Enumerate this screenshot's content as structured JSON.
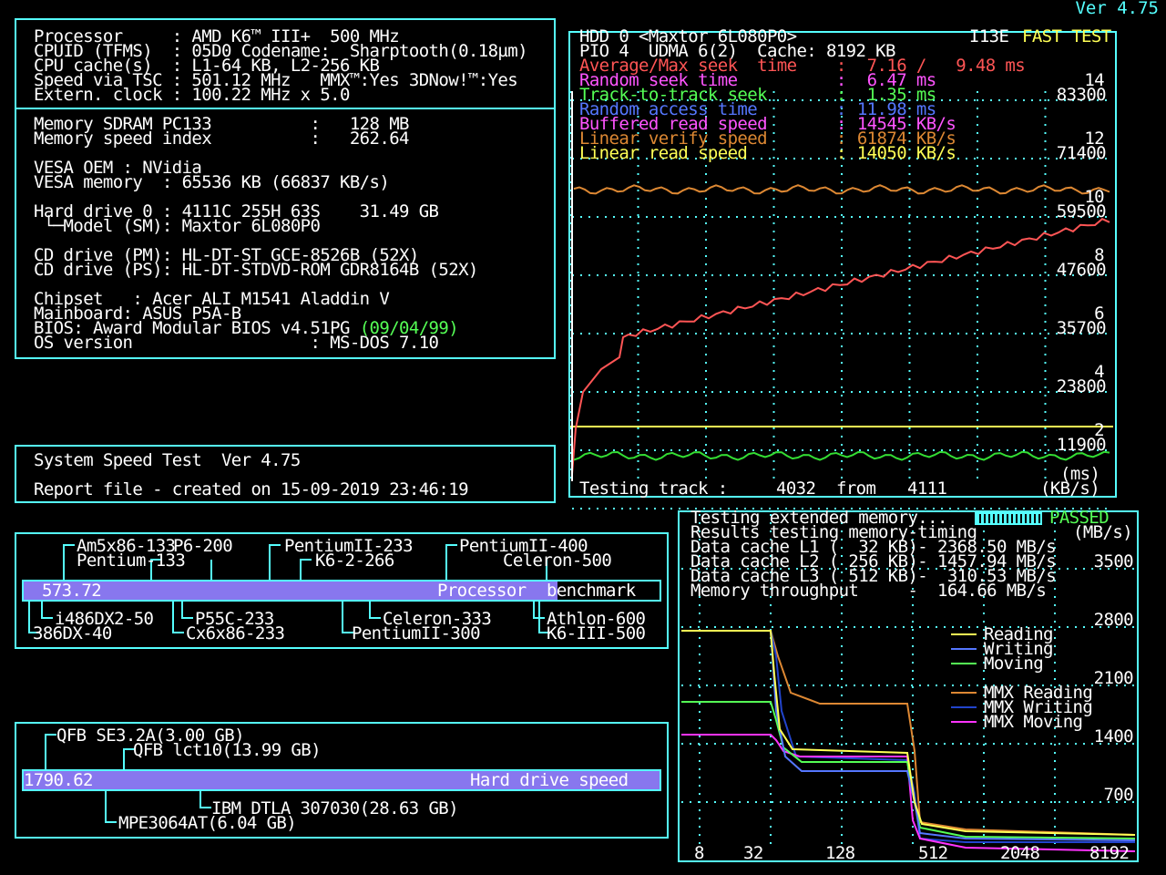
{
  "version_label": "Ver 4.75",
  "sysinfo": {
    "lines": [
      "Processor     : AMD K6™ III+  500 MHz",
      "CPUID (TFMS)  : 05D0 Codename:  Sharptooth(0.18µm)",
      "CPU cache(s)  : L1-64 KB, L2-256 KB",
      "Speed via TSC : 501.12 MHz   MMX™:Yes 3DNow!™:Yes",
      "Extern. clock : 100.22 MHz x 5.0"
    ],
    "memory_lines": [
      "Memory SDRAM PC133          :   128 MB",
      "Memory speed index          :   262.64"
    ],
    "vesa_lines": [
      "VESA OEM : NVidia",
      "VESA memory  : 65536 KB (66837 KB/s)"
    ],
    "hdd_lines": [
      "Hard drive 0 : 4111C 255H 63S    31.49 GB",
      " └─Model (SM): Maxtor 6L080P0"
    ],
    "cd_lines": [
      "CD drive (PM): HL-DT-ST GCE-8526B (52X)",
      "CD drive (PS): HL-DT-STDVD-ROM GDR8164B (52X)"
    ],
    "chip_lines": [
      "Chipset   : Acer ALI M1541 Aladdin V",
      "Mainboard: ASUS P5A-B"
    ],
    "bios_prefix": "BIOS: Award Modular BIOS v4.51PG ",
    "bios_date": "(09/04/99)",
    "os_line": "OS version                  : MS-DOS 7.10"
  },
  "report": {
    "line1": "System Speed Test  Ver 4.75",
    "line2": "Report file - created on 15-09-2019 23:46:19"
  },
  "hdd_test": {
    "header1": "HDD 0 <Maxtor 6L080P0>",
    "header1_right_a": "I13E",
    "header1_right_b": "FAST TEST",
    "header2": "PIO 4  UDMA 6(2)  Cache: 8192 KB",
    "rows": [
      {
        "label": "Average/Max seek  time    :",
        "value": "  7.16 /   9.48 ms",
        "color": "#ff5555"
      },
      {
        "label": "Random seek time          :",
        "value": "  6.47 ms",
        "color": "#ff55ff"
      },
      {
        "label": "Track-to-track seek       :",
        "value": "  1.35 ms",
        "color": "#55ff55"
      },
      {
        "label": "Random access time        :",
        "value": " 11.98 ms",
        "color": "#5577ff"
      },
      {
        "label": "Buffered read speed       :",
        "value": " 14545 KB/s",
        "color": "#ff55ff"
      },
      {
        "label": "Linear verify speed       :",
        "value": " 61874 KB/s",
        "color": "#dd8833"
      },
      {
        "label": "Linear read speed         :",
        "value": " 14050 KB/s",
        "color": "#ffff55"
      }
    ],
    "right_ms_ticks": [
      "14",
      "12",
      "10",
      "8",
      "6",
      "4",
      "2"
    ],
    "right_kbs_ticks": [
      "83300",
      "71400",
      "59500",
      "47600",
      "35700",
      "23800",
      "11900"
    ],
    "unit_ms": "(ms)",
    "unit_kbs": "(KB/s)",
    "status_prefix": "Testing track :",
    "status_track": "4032",
    "status_from": "from",
    "status_total": "4111"
  },
  "cpu_bench": {
    "top_labels_row1": [
      "Am5x86-133",
      "P6-200",
      "PentiumII-233",
      "PentiumII-400"
    ],
    "top_labels_row2": [
      "Pentium-133",
      "K6-2-266",
      "Celeron-500"
    ],
    "score": "573.72",
    "bar_label": "Processor",
    "bar_label2": "benchmark",
    "bottom_labels_row1": [
      "i486DX2-50",
      "P55C-233",
      "Celeron-333",
      "Athlon-600"
    ],
    "bottom_labels_row2": [
      "386DX-40",
      "Cx6x86-233",
      "PentiumII-300",
      "K6-III-500"
    ]
  },
  "hdd_bench": {
    "top_labels": [
      "QFB SE3.2A(3.00 GB)",
      "QFB lct10(13.99 GB)"
    ],
    "score": "1790.62",
    "bar_label": "Hard drive speed",
    "bottom_labels": [
      "IBM DTLA 307030(28.63 GB)",
      "MPE3064AT(6.04 GB)"
    ]
  },
  "mem_test": {
    "line1": "Testing extended memory...",
    "passed": "PASSED",
    "line2": "Results testing memory-timing",
    "unit": "(MB/s)",
    "rows": [
      "Data cache L1 (  32 KB)- 2368.50 MB/s",
      "Data cache L2 ( 256 KB)- 1457.94 MB/s",
      "Data cache L3 ( 512 KB)-  310.53 MB/s",
      "Memory throughput     -  164.66 MB/s"
    ],
    "y_ticks": [
      "3500",
      "2800",
      "2100",
      "1400",
      "700"
    ],
    "x_ticks": [
      "8",
      "32",
      "128",
      "512",
      "2048",
      "8192"
    ],
    "legend": [
      {
        "label": "Reading",
        "color": "#ffff55"
      },
      {
        "label": "Writing",
        "color": "#5577ff"
      },
      {
        "label": "Moving",
        "color": "#55ff55"
      },
      {
        "label": "MMX Reading",
        "color": "#dd8833"
      },
      {
        "label": "MMX Writing",
        "color": "#2244cc"
      },
      {
        "label": "MMX Moving",
        "color": "#ff33ff"
      }
    ]
  }
}
